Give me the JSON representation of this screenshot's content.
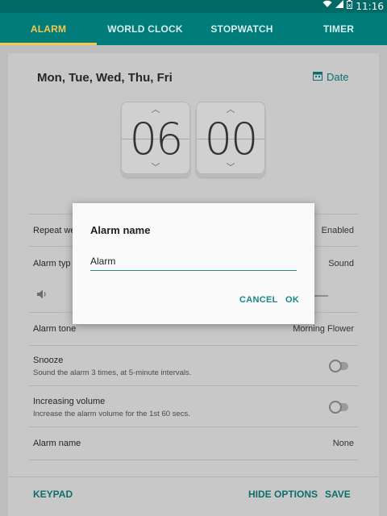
{
  "status_bar": {
    "time": "11:16",
    "icons": [
      "wifi-icon",
      "signal-icon",
      "battery-icon"
    ]
  },
  "tabs": [
    {
      "label": "ALARM",
      "active": true
    },
    {
      "label": "WORLD CLOCK",
      "active": false
    },
    {
      "label": "STOPWATCH",
      "active": false
    },
    {
      "label": "TIMER",
      "active": false
    }
  ],
  "alarm": {
    "days": "Mon, Tue, Wed, Thu, Fri",
    "date_label": "Date",
    "hour": "06",
    "minute": "00"
  },
  "settings": {
    "repeat": {
      "label": "Repeat we",
      "value": "Enabled"
    },
    "alarm_type": {
      "label": "Alarm typ",
      "value": "Sound"
    },
    "alarm_tone": {
      "label": "Alarm tone",
      "value": "Morning Flower"
    },
    "snooze": {
      "label": "Snooze",
      "sub": "Sound the alarm 3 times, at 5-minute intervals.",
      "on": false
    },
    "increasing_volume": {
      "label": "Increasing volume",
      "sub": "Increase the alarm volume for the 1st 60 secs.",
      "on": false
    },
    "alarm_name": {
      "label": "Alarm name",
      "value": "None"
    }
  },
  "bottom_bar": {
    "keypad": "KEYPAD",
    "hide_options": "HIDE OPTIONS",
    "save": "SAVE"
  },
  "dialog": {
    "title": "Alarm name",
    "input_value": "Alarm",
    "cancel": "CANCEL",
    "ok": "OK"
  },
  "colors": {
    "header": "#007d7a",
    "status_bar": "#006a66",
    "active_tab": "#f6c74f",
    "accent": "#1a8884"
  }
}
